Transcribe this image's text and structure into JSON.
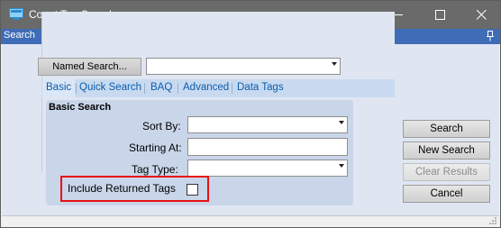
{
  "window": {
    "title": "Count Tag Search",
    "icon": "app-window-icon"
  },
  "search_bar": {
    "label": "Search",
    "pin_icon": "pin-icon"
  },
  "named_search": {
    "button_label": "Named Search...",
    "value": ""
  },
  "tabs": [
    {
      "label": "Basic",
      "active": true
    },
    {
      "label": "Quick Search",
      "active": false
    },
    {
      "label": "BAQ",
      "active": false
    },
    {
      "label": "Advanced",
      "active": false
    },
    {
      "label": "Data Tags",
      "active": false
    }
  ],
  "basic_search": {
    "title": "Basic Search",
    "sort_by_label": "Sort By:",
    "sort_by_value": "",
    "starting_at_label": "Starting At:",
    "starting_at_value": "",
    "tag_type_label": "Tag Type:",
    "tag_type_value": "",
    "include_returned_label": "Include Returned Tags",
    "include_returned_checked": false
  },
  "actions": {
    "search": "Search",
    "new_search": "New Search",
    "clear_results": "Clear Results",
    "cancel": "Cancel"
  },
  "colors": {
    "titlebar": "#6a6a6a",
    "search_bar": "#3f6cb6",
    "tab_text": "#0b5cad",
    "highlight": "#e81010"
  }
}
